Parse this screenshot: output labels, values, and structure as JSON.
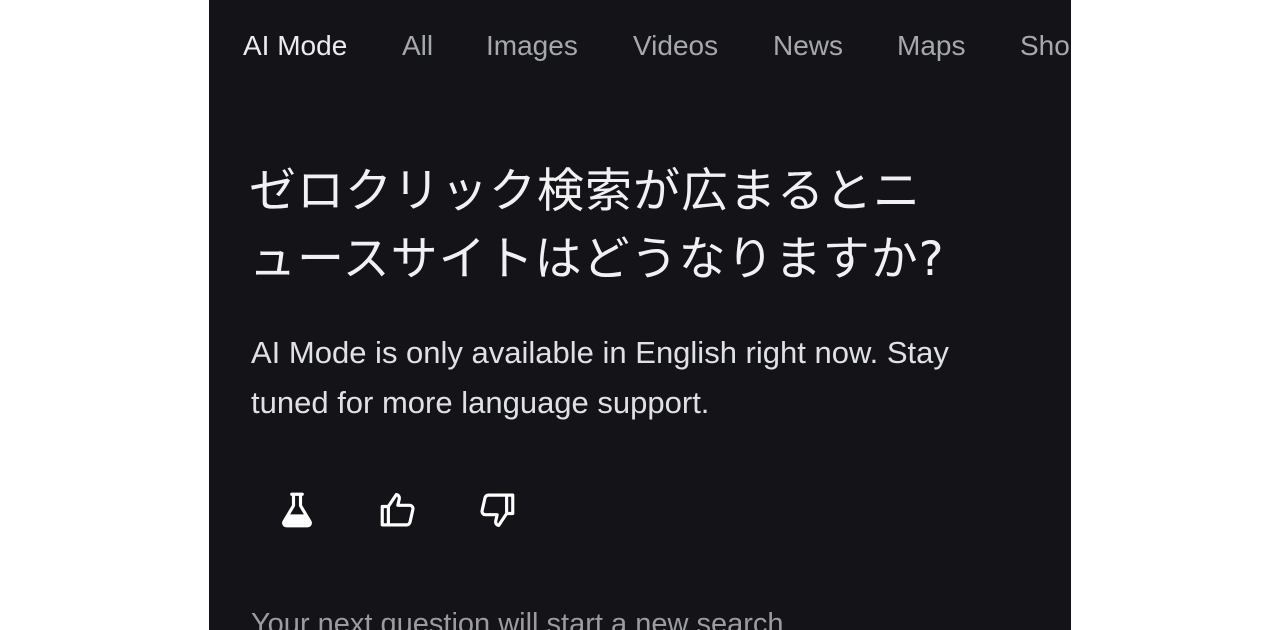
{
  "tabs": [
    {
      "label": "AI Mode",
      "active": true
    },
    {
      "label": "All"
    },
    {
      "label": "Images"
    },
    {
      "label": "Videos"
    },
    {
      "label": "News"
    },
    {
      "label": "Maps"
    },
    {
      "label": "Sho"
    }
  ],
  "query": {
    "line1": "ゼロクリック検索が広まるとニ",
    "line2": "ュースサイトはどうなりますか?"
  },
  "notice": {
    "line1": "AI Mode is only available in English right now. Stay",
    "line2": "tuned for more language support."
  },
  "actions": {
    "icons": [
      "flask-icon",
      "thumbs-up-icon",
      "thumbs-down-icon"
    ]
  },
  "footer": {
    "note": "Your next question will start a new search"
  },
  "colors": {
    "background": "#141418",
    "text_primary": "#f1f1f3",
    "text_secondary": "#a6a8ad"
  }
}
